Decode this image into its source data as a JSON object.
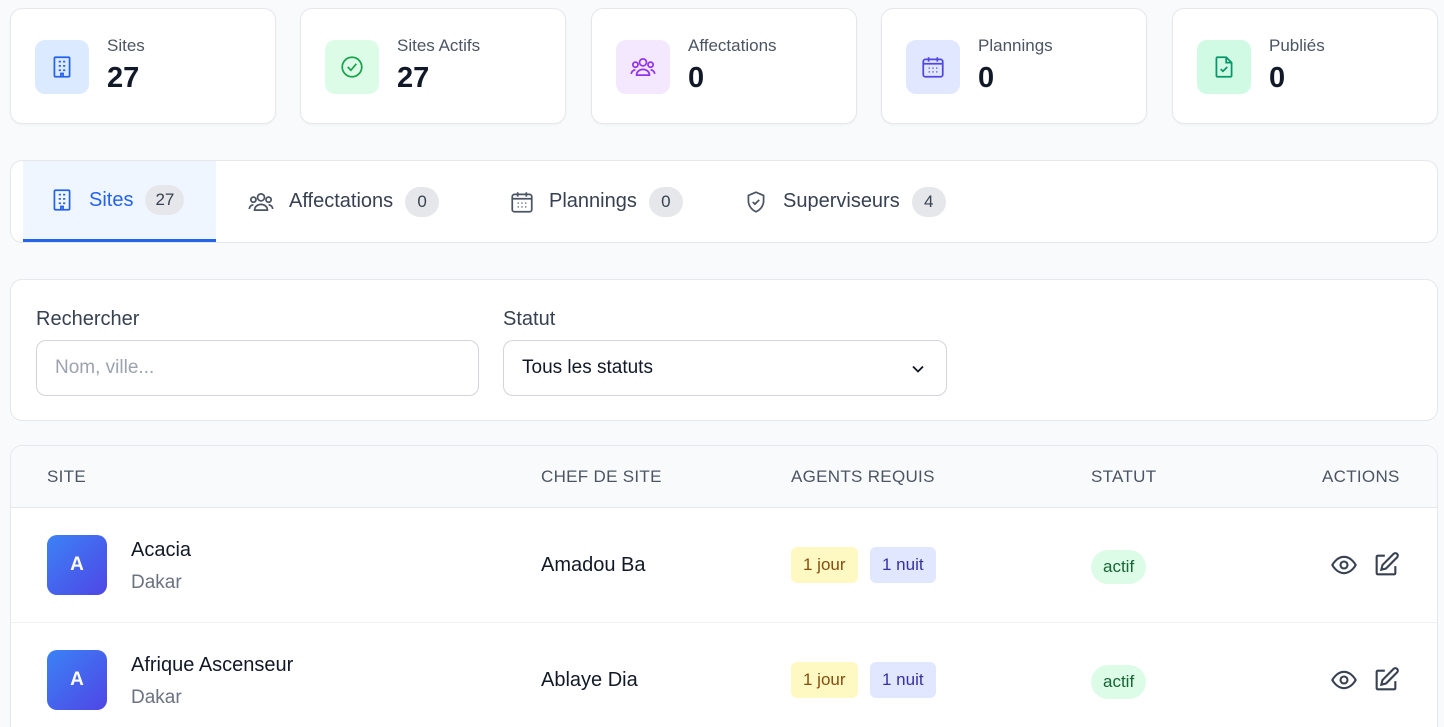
{
  "stats": [
    {
      "label": "Sites",
      "value": "27",
      "icon": "building-icon",
      "bg": "#dbeafe",
      "color": "#2563eb"
    },
    {
      "label": "Sites Actifs",
      "value": "27",
      "icon": "check-circle-icon",
      "bg": "#dcfce7",
      "color": "#16a34a"
    },
    {
      "label": "Affectations",
      "value": "0",
      "icon": "users-icon",
      "bg": "#f3e8ff",
      "color": "#9333ea"
    },
    {
      "label": "Plannings",
      "value": "0",
      "icon": "calendar-icon",
      "bg": "#e0e7ff",
      "color": "#4f46e5"
    },
    {
      "label": "Publiés",
      "value": "0",
      "icon": "file-check-icon",
      "bg": "#d1fae5",
      "color": "#059669"
    }
  ],
  "tabs": [
    {
      "label": "Sites",
      "count": "27",
      "icon": "building-icon",
      "active": true
    },
    {
      "label": "Affectations",
      "count": "0",
      "icon": "users-icon",
      "active": false
    },
    {
      "label": "Plannings",
      "count": "0",
      "icon": "calendar-icon",
      "active": false
    },
    {
      "label": "Superviseurs",
      "count": "4",
      "icon": "shield-check-icon",
      "active": false
    }
  ],
  "filters": {
    "search_label": "Rechercher",
    "search_placeholder": "Nom, ville...",
    "status_label": "Statut",
    "status_selected": "Tous les statuts"
  },
  "table": {
    "headers": [
      "SITE",
      "CHEF DE SITE",
      "AGENTS REQUIS",
      "STATUT",
      "ACTIONS"
    ],
    "rows": [
      {
        "initial": "A",
        "name": "Acacia",
        "city": "Dakar",
        "chef": "Amadou Ba",
        "day": "1 jour",
        "night": "1 nuit",
        "status": "actif"
      },
      {
        "initial": "A",
        "name": "Afrique Ascenseur",
        "city": "Dakar",
        "chef": "Ablaye Dia",
        "day": "1 jour",
        "night": "1 nuit",
        "status": "actif"
      }
    ]
  }
}
